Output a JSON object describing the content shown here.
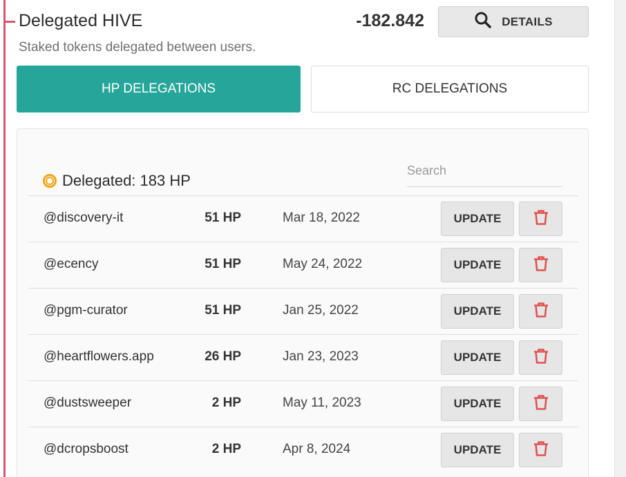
{
  "header": {
    "title": "Delegated HIVE",
    "subtitle": "Staked tokens delegated between users.",
    "amount": "-182.842",
    "details_label": "DETAILS"
  },
  "tabs": [
    {
      "label": "HP DELEGATIONS",
      "active": true
    },
    {
      "label": "RC DELEGATIONS",
      "active": false
    }
  ],
  "panel": {
    "summary_label": "Delegated: 183 HP",
    "search_placeholder": "Search"
  },
  "delegations": [
    {
      "user": "@discovery-it",
      "amount": "51 HP",
      "date": "Mar 18, 2022",
      "update_label": "UPDATE"
    },
    {
      "user": "@ecency",
      "amount": "51 HP",
      "date": "May 24, 2022",
      "update_label": "UPDATE"
    },
    {
      "user": "@pgm-curator",
      "amount": "51 HP",
      "date": "Jan 25, 2022",
      "update_label": "UPDATE"
    },
    {
      "user": "@heartflowers.app",
      "amount": "26 HP",
      "date": "Jan 23, 2023",
      "update_label": "UPDATE"
    },
    {
      "user": "@dustsweeper",
      "amount": "2 HP",
      "date": "May 11, 2023",
      "update_label": "UPDATE"
    },
    {
      "user": "@dcropsboost",
      "amount": "2 HP",
      "date": "Apr 8, 2024",
      "update_label": "UPDATE"
    }
  ],
  "colors": {
    "accent": "#26a69a",
    "rule": "#d9556f",
    "delete": "#e05252",
    "coin": "#f2a515"
  },
  "icons": {
    "details": "search-icon",
    "delete": "trash-icon",
    "summary": "coin-icon"
  }
}
